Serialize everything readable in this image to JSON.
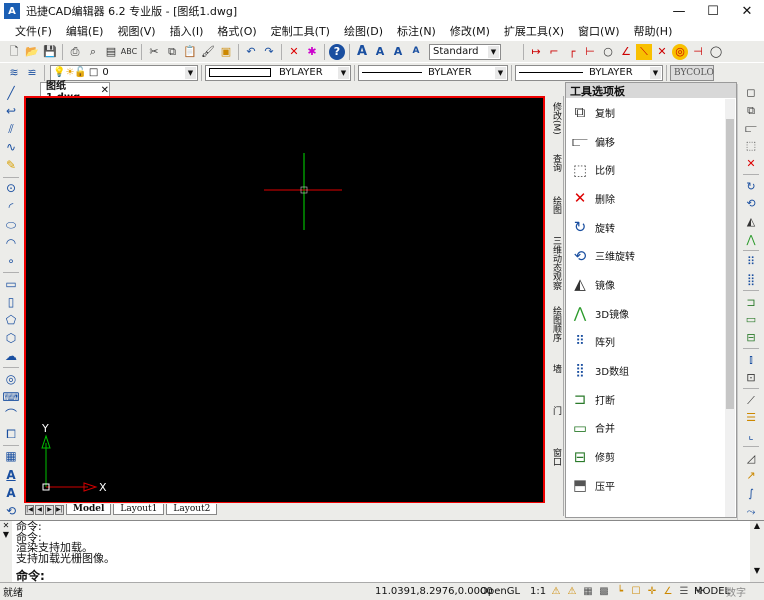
{
  "window": {
    "title": "迅捷CAD编辑器 6.2 专业版 - [图纸1.dwg]",
    "logo": "A",
    "minimize": "—",
    "maximize": "☐",
    "close": "✕"
  },
  "menu": [
    "文件(F)",
    "编辑(E)",
    "视图(V)",
    "插入(I)",
    "格式(O)",
    "定制工具(T)",
    "绘图(D)",
    "标注(N)",
    "修改(M)",
    "扩展工具(X)",
    "窗口(W)",
    "帮助(H)"
  ],
  "toolbar": {
    "text_style": "Standard",
    "layer": "0",
    "color": "BYLAYER",
    "linetype": "BYLAYER",
    "lineweight": "BYLAYER",
    "bycolor": "BYCOLO"
  },
  "document_tab": {
    "name": "图纸1.dwg",
    "close": "✕"
  },
  "canvas": {
    "background": "#000000",
    "border_color": "#e00000",
    "crosshair_color": "#00ff00",
    "crosshair_h_color": "#e00000",
    "ucs_x_label": "X",
    "ucs_y_label": "Y"
  },
  "layout_tabs": [
    "Model",
    "Layout1",
    "Layout2"
  ],
  "palette": {
    "title": "工具选项板",
    "vertical_tabs": [
      "修改(M)",
      "查询",
      "绘图",
      "三维动态观察",
      "绘图顺序",
      "墙",
      "门",
      "窗口"
    ],
    "items": [
      {
        "label": "复制",
        "icon": "copy-icon"
      },
      {
        "label": "偏移",
        "icon": "offset-icon"
      },
      {
        "label": "比例",
        "icon": "scale-icon"
      },
      {
        "label": "删除",
        "icon": "delete-icon"
      },
      {
        "label": "旋转",
        "icon": "rotate-icon"
      },
      {
        "label": "三维旋转",
        "icon": "rotate3d-icon"
      },
      {
        "label": "镜像",
        "icon": "mirror-icon"
      },
      {
        "label": "3D镜像",
        "icon": "mirror3d-icon"
      },
      {
        "label": "阵列",
        "icon": "array-icon"
      },
      {
        "label": "3D数组",
        "icon": "array3d-icon"
      },
      {
        "label": "打断",
        "icon": "break-icon"
      },
      {
        "label": "合并",
        "icon": "join-icon"
      },
      {
        "label": "修剪",
        "icon": "trim-icon"
      },
      {
        "label": "压平",
        "icon": "flatten-icon"
      }
    ]
  },
  "command": {
    "lines": [
      "命令:",
      "命令:",
      "渲染支持加载。",
      "支持加载光栅图像。"
    ],
    "prompt": "命令:"
  },
  "status": {
    "ready": "就绪",
    "coords": "11.0391,8.2976,0.0000",
    "opengl": "OpenGL",
    "scale": "1:1",
    "model": "MODEL",
    "digitizer": "数字"
  }
}
